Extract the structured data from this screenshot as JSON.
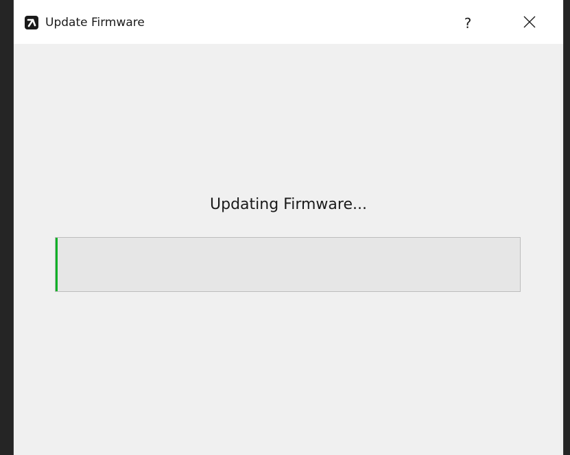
{
  "window": {
    "title": "Update Firmware",
    "help_label": "?",
    "close_icon": "close-icon",
    "app_icon": "app-logo-icon"
  },
  "main": {
    "status_text": "Updating Firmware...",
    "progress": {
      "fraction": 0.004,
      "color": "#06b025"
    }
  }
}
